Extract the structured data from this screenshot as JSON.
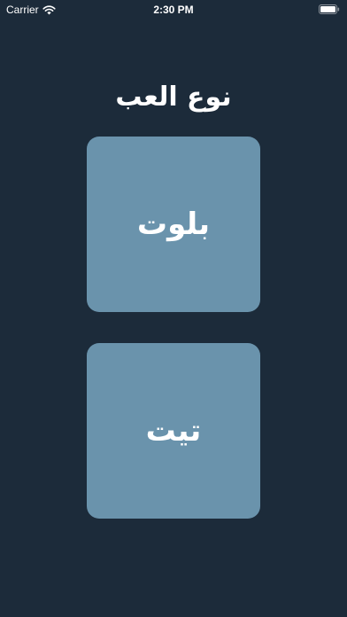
{
  "status_bar": {
    "carrier": "Carrier",
    "time": "2:30 PM",
    "icons": [
      "wifi-icon",
      "battery-icon"
    ]
  },
  "page": {
    "title": "نوع العب"
  },
  "options": [
    {
      "label": "بلوت"
    },
    {
      "label": "تيت"
    }
  ],
  "colors": {
    "background": "#1c2b3a",
    "card": "#6a93ac",
    "text": "#ffffff"
  }
}
